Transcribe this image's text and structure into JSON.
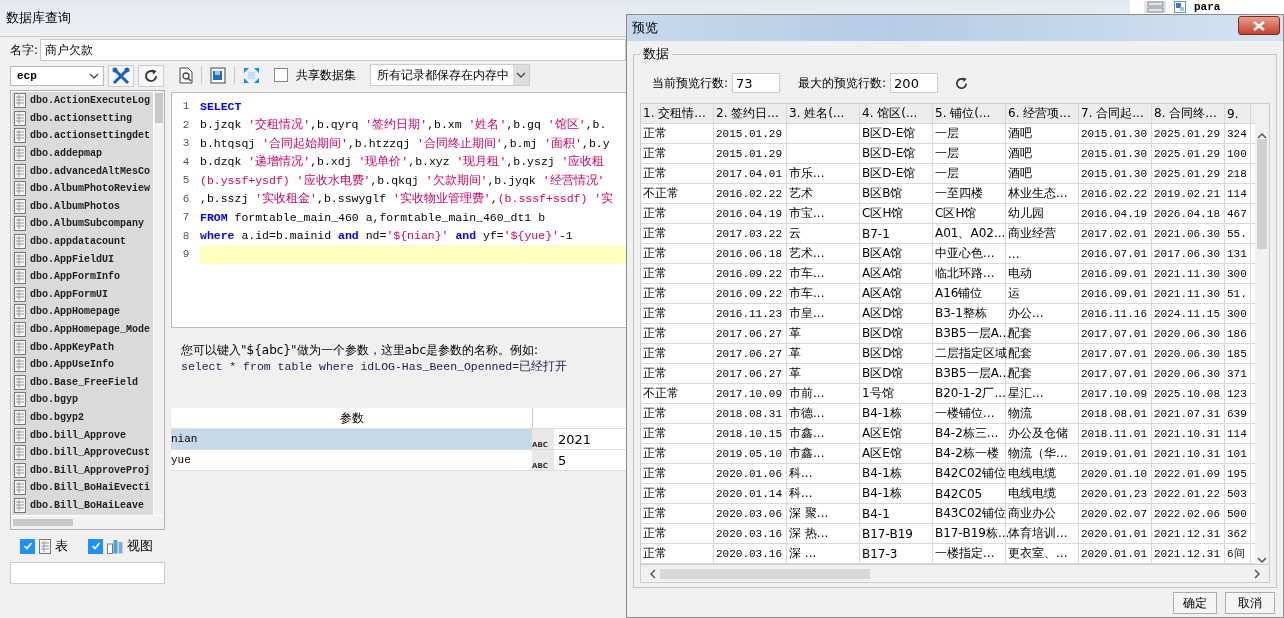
{
  "window": {
    "title": "数据库查询"
  },
  "name_field": {
    "label": "名字:",
    "value": "商户欠款"
  },
  "datasource": {
    "value": "ecp"
  },
  "tables": [
    "dbo.ActionExecuteLog",
    "dbo.actionsetting",
    "dbo.actionsettingdet",
    "dbo.addepmap",
    "dbo.advancedAltMesCo",
    "dbo.AlbumPhotoReview",
    "dbo.AlbumPhotos",
    "dbo.AlbumSubcompany",
    "dbo.appdatacount",
    "dbo.AppFieldUI",
    "dbo.AppFormInfo",
    "dbo.AppFormUI",
    "dbo.AppHomepage",
    "dbo.AppHomepage_Mode",
    "dbo.AppKeyPath",
    "dbo.AppUseInfo",
    "dbo.Base_FreeField",
    "dbo.bgyp",
    "dbo.bgyp2",
    "dbo.bill_Approve",
    "dbo.bill_ApproveCust",
    "dbo.Bill_ApproveProj",
    "dbo.Bill_BoHaiEvecti",
    "dbo.Bill_BoHaiLeave"
  ],
  "filters": [
    {
      "kind": "table",
      "label": "表",
      "checked": true
    },
    {
      "kind": "view",
      "label": "视图",
      "checked": true
    }
  ],
  "toolbar": {
    "share_dataset": {
      "label": "共享数据集",
      "checked": false
    },
    "storage_mode": {
      "value": "所有记录都保存在内存中"
    }
  },
  "sql_lines": [
    {
      "number": "1",
      "current": false,
      "tokens": [
        {
          "kind": "keyword",
          "text": "SELECT"
        }
      ]
    },
    {
      "number": "2",
      "current": false,
      "tokens": [
        {
          "kind": "plain",
          "text": "b.jzqk "
        },
        {
          "kind": "string",
          "text": "'交租情况'"
        },
        {
          "kind": "plain",
          "text": ",b.qyrq "
        },
        {
          "kind": "string",
          "text": "'签约日期'"
        },
        {
          "kind": "plain",
          "text": ",b.xm "
        },
        {
          "kind": "string",
          "text": "'姓名'"
        },
        {
          "kind": "plain",
          "text": ",b.gq "
        },
        {
          "kind": "string",
          "text": "'馆区'"
        },
        {
          "kind": "plain",
          "text": ",b."
        }
      ]
    },
    {
      "number": "3",
      "current": false,
      "tokens": [
        {
          "kind": "plain",
          "text": "b.htqsqj "
        },
        {
          "kind": "string",
          "text": "'合同起始期间'"
        },
        {
          "kind": "plain",
          "text": ",b.htzzqj "
        },
        {
          "kind": "string",
          "text": "'合同终止期间'"
        },
        {
          "kind": "plain",
          "text": ",b.mj "
        },
        {
          "kind": "string",
          "text": "'面积'"
        },
        {
          "kind": "plain",
          "text": ",b.y"
        }
      ]
    },
    {
      "number": "4",
      "current": false,
      "tokens": [
        {
          "kind": "plain",
          "text": "b.dzqk "
        },
        {
          "kind": "string",
          "text": "'递增情况'"
        },
        {
          "kind": "plain",
          "text": ",b.xdj "
        },
        {
          "kind": "string",
          "text": "'现单价'"
        },
        {
          "kind": "plain",
          "text": ",b.xyz "
        },
        {
          "kind": "string",
          "text": "'现月租'"
        },
        {
          "kind": "plain",
          "text": ",b.yszj "
        },
        {
          "kind": "string",
          "text": "'应收租"
        }
      ]
    },
    {
      "number": "5",
      "current": false,
      "tokens": [
        {
          "kind": "string",
          "text": "(b.yssf+ysdf) '应收水电费'"
        },
        {
          "kind": "plain",
          "text": ",b.qkqj "
        },
        {
          "kind": "string",
          "text": "'欠款期间'"
        },
        {
          "kind": "plain",
          "text": ",b.jyqk "
        },
        {
          "kind": "string",
          "text": "'经营情况'"
        }
      ]
    },
    {
      "number": "6",
      "current": false,
      "tokens": [
        {
          "kind": "plain",
          "text": ",b.sszj "
        },
        {
          "kind": "string",
          "text": "'实收租金'"
        },
        {
          "kind": "plain",
          "text": ",b.sswyglf "
        },
        {
          "kind": "string",
          "text": "'实收物业管理费'"
        },
        {
          "kind": "plain",
          "text": ","
        },
        {
          "kind": "string",
          "text": "(b.sssf+ssdf) '实"
        }
      ]
    },
    {
      "number": "7",
      "current": false,
      "tokens": [
        {
          "kind": "keyword",
          "text": "FROM"
        },
        {
          "kind": "plain",
          "text": " formtable_main_460 a,formtable_main_460_dt1 b"
        }
      ]
    },
    {
      "number": "8",
      "current": false,
      "tokens": [
        {
          "kind": "keyword",
          "text": "where"
        },
        {
          "kind": "plain",
          "text": " a.id=b.mainid "
        },
        {
          "kind": "keyword",
          "text": "and"
        },
        {
          "kind": "plain",
          "text": " nd="
        },
        {
          "kind": "string",
          "text": "'${nian}'"
        },
        {
          "kind": "keyword",
          "text": " and"
        },
        {
          "kind": "plain",
          "text": " yf="
        },
        {
          "kind": "string",
          "text": "'${yue}'"
        },
        {
          "kind": "plain",
          "text": "-1"
        }
      ]
    },
    {
      "number": "9",
      "current": true
    }
  ],
  "hint": {
    "line_1": "您可以键入\"${abc}\"做为一个参数，这里abc是参数的名称。例如:",
    "line_2": "select * from table where idLOG-Has_Been_Openned=已经打开"
  },
  "parameters": {
    "header": "参数",
    "rows": [
      {
        "name": "nian",
        "type_label": "ABC",
        "value": "2021",
        "selected": true
      },
      {
        "name": "yue",
        "type_label": "ABC",
        "value": "5",
        "selected": false
      }
    ]
  },
  "background_window": {
    "label": "para"
  },
  "preview": {
    "title": "预览",
    "group": "数据",
    "current_rows": {
      "label": "当前预览行数:",
      "value": "73"
    },
    "max_rows": {
      "label": "最大的预览行数:",
      "value": "200"
    },
    "columns": [
      "1. 交租情...",
      "2. 签约日...",
      "3. 姓名(...",
      "4. 馆区(...",
      "5. 铺位(...",
      "6. 经营项...",
      "7. 合同起...",
      "8. 合同终...",
      "9."
    ],
    "rows": [
      [
        "正常",
        "2015.01.29",
        null,
        "B区D-E馆",
        "一层",
        "酒吧",
        "2015.01.30",
        "2025.01.29",
        "324"
      ],
      [
        "正常",
        "2015.01.29",
        null,
        "B区D-E馆",
        "一层",
        "酒吧",
        "2015.01.30",
        "2025.01.29",
        "100"
      ],
      [
        "正常",
        "2017.04.01",
        "市乐...",
        "B区D-E馆",
        "一层",
        "酒吧",
        "2015.01.30",
        "2025.01.29",
        "218"
      ],
      [
        "不正常",
        "2016.02.22",
        "艺术",
        "B区B馆",
        "一至四楼",
        "林业生态...",
        "2016.02.22",
        "2019.02.21",
        "114"
      ],
      [
        "正常",
        "2016.04.19",
        "市宝...",
        "C区H馆",
        "C区H馆",
        "幼儿园",
        "2016.04.19",
        "2026.04.18",
        "467"
      ],
      [
        "正常",
        "2017.03.22",
        "云",
        "B7-1",
        "A01、A02...",
        "商业经营",
        "2017.02.01",
        "2021.06.30",
        "55."
      ],
      [
        "正常",
        "2016.06.18",
        "艺术...",
        "B区A馆",
        "中亚心色...",
        "...",
        "2016.07.01",
        "2017.06.30",
        "131"
      ],
      [
        "正常",
        "2016.09.22",
        "市车...",
        "A区A馆",
        "临北环路...",
        "电动",
        "2016.09.01",
        "2021.11.30",
        "300"
      ],
      [
        "正常",
        "2016.09.22",
        "市车...",
        "A区A馆",
        "A16铺位",
        "运",
        "2016.09.01",
        "2021.11.30",
        "51."
      ],
      [
        "正常",
        "2016.11.23",
        "市皇...",
        "A区D馆",
        "B3-1整栋",
        "办公...",
        "2016.11.16",
        "2024.11.15",
        "300"
      ],
      [
        "正常",
        "2017.06.27",
        "革",
        "B区D馆",
        "B3B5一层A...",
        "配套",
        "2017.07.01",
        "2020.06.30",
        "186"
      ],
      [
        "正常",
        "2017.06.27",
        "革",
        "B区D馆",
        "二层指定区域",
        "配套",
        "2017.07.01",
        "2020.06.30",
        "185"
      ],
      [
        "正常",
        "2017.06.27",
        "革",
        "B区D馆",
        "B3B5一层A...",
        "配套",
        "2017.07.01",
        "2020.06.30",
        "371"
      ],
      [
        "不正常",
        "2017.10.09",
        "市前...",
        "1号馆",
        "B20-1-2厂...",
        "星汇...",
        "2017.10.09",
        "2025.10.08",
        "123"
      ],
      [
        "正常",
        "2018.08.31",
        "市德...",
        "B4-1栋",
        "一楼铺位...",
        "物流",
        "2018.08.01",
        "2021.07.31",
        "639"
      ],
      [
        "正常",
        "2018.10.15",
        "市鑫...",
        "A区E馆",
        "B4-2栋三...",
        "办公及仓储",
        "2018.11.01",
        "2021.10.31",
        "114"
      ],
      [
        "正常",
        "2019.05.10",
        "市鑫...",
        "A区E馆",
        "B4-2栋一楼",
        "物流（华...",
        "2019.01.01",
        "2021.10.31",
        "101"
      ],
      [
        "正常",
        "2020.01.06",
        "科...",
        "B4-1栋",
        "B42C02铺位",
        "电线电缆",
        "2020.01.10",
        "2022.01.09",
        "195"
      ],
      [
        "正常",
        "2020.01.14",
        "科...",
        "B4-1栋",
        "B42C05",
        "电线电缆",
        "2020.01.23",
        "2022.01.22",
        "503"
      ],
      [
        "正常",
        "2020.03.06",
        "深 聚...",
        "B4-1",
        "B43C02铺位",
        "商业办公",
        "2020.02.07",
        "2022.02.06",
        "500"
      ],
      [
        "正常",
        "2020.03.16",
        "深 热...",
        "B17-B19",
        "B17-B19栋...",
        "体育培训...",
        "2020.01.01",
        "2021.12.31",
        "362"
      ],
      [
        "正常",
        "2020.03.16",
        "深 ...",
        "B17-3",
        "一楼指定...",
        "更衣室、...",
        "2020.01.01",
        "2021.12.31",
        "6间"
      ]
    ],
    "buttons": [
      "确定",
      "取消"
    ]
  }
}
